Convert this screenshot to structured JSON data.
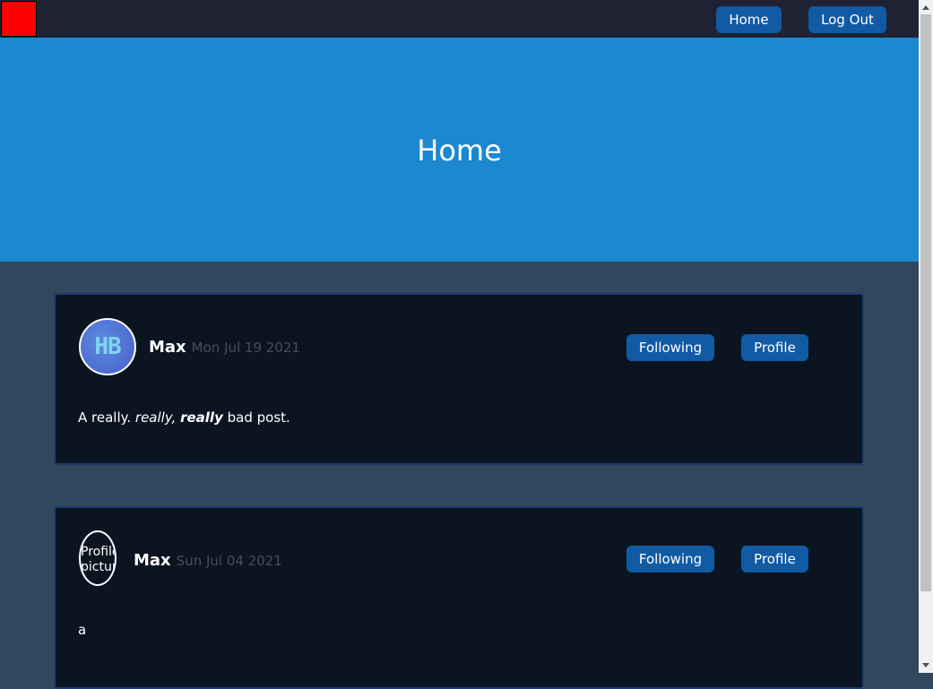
{
  "nav": {
    "home_label": "Home",
    "logout_label": "Log Out"
  },
  "hero": {
    "title": "Home"
  },
  "posts": [
    {
      "avatar_text": "HB",
      "username": "Max",
      "date": "Mon Jul 19 2021",
      "follow_label": "Following",
      "profile_label": "Profile",
      "body_plain1": "A really. ",
      "body_italic": "really,",
      "body_bold_italic": "really",
      "body_plain2": " bad post."
    },
    {
      "avatar_alt": "Profile picture",
      "username": "Max",
      "date": "Sun Jul 04 2021",
      "follow_label": "Following",
      "profile_label": "Profile",
      "body": "a"
    }
  ],
  "colors": {
    "navbar": "#1f2233",
    "hero": "#1b88d0",
    "page": "#30475e",
    "card": "#0b1521",
    "button": "#115aa4",
    "logo": "#ff0000"
  }
}
